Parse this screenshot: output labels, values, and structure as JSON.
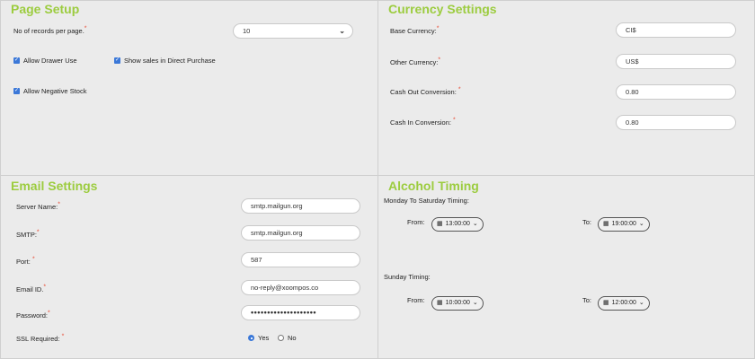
{
  "page_setup": {
    "title": "Page Setup",
    "records_label": "No of records per page.",
    "records_value": "10",
    "allow_drawer": "Allow Drawer Use",
    "show_sales": "Show sales in Direct Purchase",
    "allow_negative": "Allow Negative Stock"
  },
  "currency": {
    "title": "Currency Settings",
    "base_label": "Base Currency:",
    "base_value": "CI$",
    "other_label": "Other Currency:",
    "other_value": "US$",
    "cashout_label": "Cash Out Conversion:",
    "cashout_value": "0.80",
    "cashin_label": "Cash In Conversion:",
    "cashin_value": "0.80"
  },
  "email": {
    "title": "Email Settings",
    "server_label": "Server Name:",
    "server_value": "smtp.mailgun.org",
    "smtp_label": "SMTP:",
    "smtp_value": "smtp.mailgun.org",
    "port_label": "Port:",
    "port_value": "587",
    "email_label": "Email ID.",
    "email_value": "no-reply@xoompos.co",
    "password_label": "Password:",
    "password_value": "••••••••••••••••••••",
    "ssl_label": "SSL  Required:",
    "ssl_yes": "Yes",
    "ssl_no": "No"
  },
  "alcohol": {
    "title": "Alcohol Timing",
    "weekday_label": "Monday To Saturday Timing:",
    "from_label": "From:",
    "to_label": "To:",
    "weekday_from": "13:00:00",
    "weekday_to": "19:00:00",
    "sunday_label": "Sunday Timing:",
    "sunday_from": "10:00:00",
    "sunday_to": "12:00:00"
  },
  "required_mark": "*"
}
